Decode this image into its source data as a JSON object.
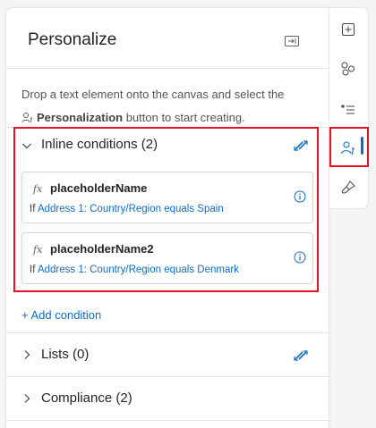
{
  "panel": {
    "title": "Personalize",
    "description_before": "Drop a text element onto the canvas and select the",
    "description_bold": "Personalization",
    "description_after": " button to start creating."
  },
  "sections": {
    "inline": {
      "title": "Inline conditions (2)",
      "conditions": [
        {
          "fx": "fx",
          "name": "placeholderName",
          "if_prefix": "If ",
          "rule": "Address 1: Country/Region equals Spain"
        },
        {
          "fx": "fx",
          "name": "placeholderName2",
          "if_prefix": "If ",
          "rule": "Address 1: Country/Region equals Denmark"
        }
      ],
      "add_label": "+ Add condition"
    },
    "lists": {
      "title": "Lists (0)"
    },
    "compliance": {
      "title": "Compliance (2)"
    }
  },
  "rail": {
    "items": [
      "add-element-icon",
      "elements-icon",
      "styles-icon",
      "personalize-icon",
      "paintbrush-icon"
    ],
    "active": "personalize-icon"
  },
  "colors": {
    "accent": "#0f6cbd",
    "highlight": "#e81123"
  }
}
